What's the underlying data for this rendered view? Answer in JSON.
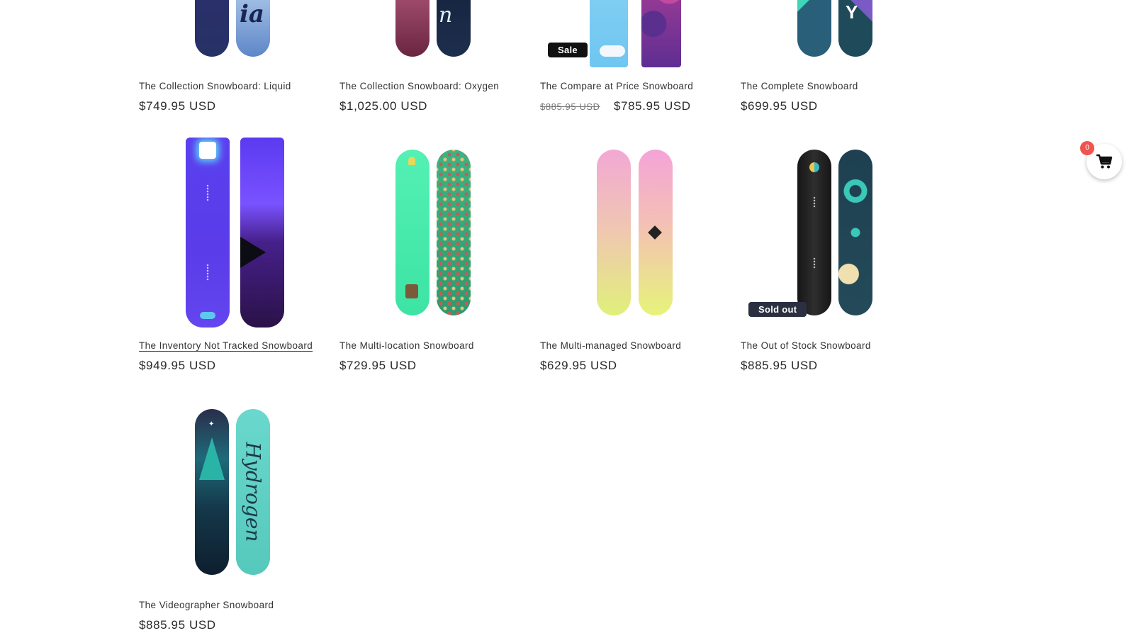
{
  "products": [
    {
      "title": "The Collection Snowboard: Liquid",
      "price": "$749.95 USD"
    },
    {
      "title": "The Collection Snowboard: Oxygen",
      "price": "$1,025.00 USD"
    },
    {
      "title": "The Compare at Price Snowboard",
      "compare_price": "$885.95 USD",
      "price": "$785.95 USD",
      "badge": "Sale"
    },
    {
      "title": "The Complete Snowboard",
      "price": "$699.95 USD"
    },
    {
      "title": "The Inventory Not Tracked Snowboard",
      "price": "$949.95 USD"
    },
    {
      "title": "The Multi-location Snowboard",
      "price": "$729.95 USD"
    },
    {
      "title": "The Multi-managed Snowboard",
      "price": "$629.95 USD"
    },
    {
      "title": "The Out of Stock Snowboard",
      "price": "$885.95 USD",
      "badge": "Sold out"
    },
    {
      "title": "The Videographer Snowboard",
      "price": "$885.95 USD"
    }
  ],
  "cart": {
    "count": "0",
    "icon": "cart-icon"
  },
  "board_image_text": {
    "liquid": "Liquid",
    "oxygen": "Oxygen",
    "hydrogen": "Hydrogen"
  },
  "colors": {
    "sale_badge": "#111111",
    "soldout_badge": "#2a3040",
    "cart_count": "#f0544f"
  }
}
